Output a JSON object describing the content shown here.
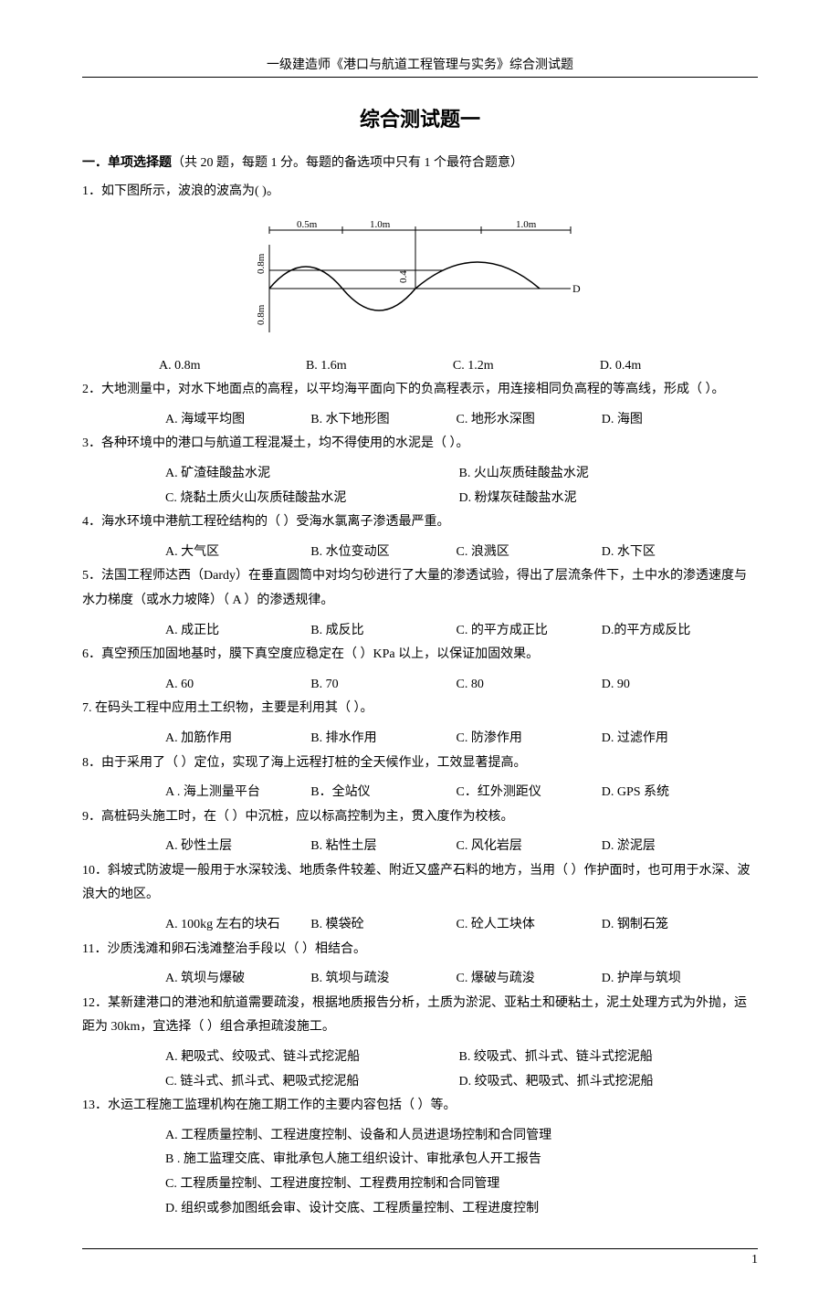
{
  "header": "一级建造师《港口与航道工程管理与实务》综合测试题",
  "title": "综合测试题一",
  "section": {
    "bold": "一．单项选择题",
    "rest": "（共 20 题，每题 1 分。每题的备选项中只有 1 个最符合题意）"
  },
  "q1": {
    "stem": "1．如下图所示，波浪的波高为(        )。",
    "optA": "A. 0.8m",
    "optB": "B. 1.6m",
    "optC": "C. 1.2m",
    "optD": "D. 0.4m",
    "diagram": {
      "d_top1": "0.5m",
      "d_top2": "1.0m",
      "d_top3": "1.0m",
      "d_left_up": "0.8m",
      "d_left_dn": "0.8m",
      "d_mid": "0.4",
      "d_right": "D"
    }
  },
  "q2": {
    "stem": "2．大地测量中，对水下地面点的高程，以平均海平面向下的负高程表示，用连接相同负高程的等高线，形成（        ）。",
    "optA": "A. 海域平均图",
    "optB": "B. 水下地形图",
    "optC": "C. 地形水深图",
    "optD": "D. 海图"
  },
  "q3": {
    "stem": "3．各种环境中的港口与航道工程混凝土，均不得使用的水泥是（        ）。",
    "optA": "A. 矿渣硅酸盐水泥",
    "optB": "B. 火山灰质硅酸盐水泥",
    "optC": "C. 烧黏土质火山灰质硅酸盐水泥",
    "optD": "D. 粉煤灰硅酸盐水泥"
  },
  "q4": {
    "stem": "4．海水环境中港航工程砼结构的（        ）受海水氯离子渗透最严重。",
    "optA": "A. 大气区",
    "optB": "B. 水位变动区",
    "optC": "C. 浪溅区",
    "optD": "D. 水下区"
  },
  "q5": {
    "stem": "5．法国工程师达西（Dardy）在垂直圆筒中对均匀砂进行了大量的渗透试验，得出了层流条件下，土中水的渗透速度与水力梯度（或水力坡降）（   A    ）的渗透规律。",
    "optA": "A. 成正比",
    "optB": "B. 成反比",
    "optC": "C. 的平方成正比",
    "optD": "D.的平方成反比"
  },
  "q6": {
    "stem": "6．真空预压加固地基时，膜下真空度应稳定在（        ）KPa 以上，以保证加固效果。",
    "optA": "A. 60",
    "optB": "B. 70",
    "optC": "C. 80",
    "optD": "D. 90"
  },
  "q7": {
    "stem": "7. 在码头工程中应用土工织物，主要是利用其（        ）。",
    "optA": "A. 加筋作用",
    "optB": "B. 排水作用",
    "optC": "C. 防渗作用",
    "optD": "D. 过滤作用"
  },
  "q8": {
    "stem": "8．由于采用了（        ）定位，实现了海上远程打桩的全天候作业，工效显著提高。",
    "optA": "A . 海上测量平台",
    "optB": "B．全站仪",
    "optC": "C．红外测距仪",
    "optD": "D. GPS 系统"
  },
  "q9": {
    "stem": "9．高桩码头施工时，在（        ）中沉桩，应以标高控制为主，贯入度作为校核。",
    "optA": "A. 砂性土层",
    "optB": "B. 粘性土层",
    "optC": "C. 风化岩层",
    "optD": "D. 淤泥层"
  },
  "q10": {
    "stem": "10．斜坡式防波堤一般用于水深较浅、地质条件较差、附近又盛产石料的地方，当用（        ）作护面时，也可用于水深、波浪大的地区。",
    "optA": "A. 100kg 左右的块石",
    "optB": "B. 模袋砼",
    "optC": "C. 砼人工块体",
    "optD": "D. 钢制石笼"
  },
  "q11": {
    "stem": "11．沙质浅滩和卵石浅滩整治手段以（        ）相结合。",
    "optA": "A. 筑坝与爆破",
    "optB": "B. 筑坝与疏浚",
    "optC": "C. 爆破与疏浚",
    "optD": "D. 护岸与筑坝"
  },
  "q12": {
    "stem": "12．某新建港口的港池和航道需要疏浚，根据地质报告分析，土质为淤泥、亚粘土和硬粘土，泥土处理方式为外抛，运距为 30km，宜选择（        ）组合承担疏浚施工。",
    "optA": "A. 耙吸式、绞吸式、链斗式挖泥船",
    "optB": "B. 绞吸式、抓斗式、链斗式挖泥船",
    "optC": "C. 链斗式、抓斗式、耙吸式挖泥船",
    "optD": "D. 绞吸式、耙吸式、抓斗式挖泥船"
  },
  "q13": {
    "stem": "13．水运工程施工监理机构在施工期工作的主要内容包括（        ）等。",
    "optA": "A. 工程质量控制、工程进度控制、设备和人员进退场控制和合同管理",
    "optB": "B . 施工监理交底、审批承包人施工组织设计、审批承包人开工报告",
    "optC": "C. 工程质量控制、工程进度控制、工程费用控制和合同管理",
    "optD": "D. 组织或参加图纸会审、设计交底、工程质量控制、工程进度控制"
  },
  "page": "1"
}
